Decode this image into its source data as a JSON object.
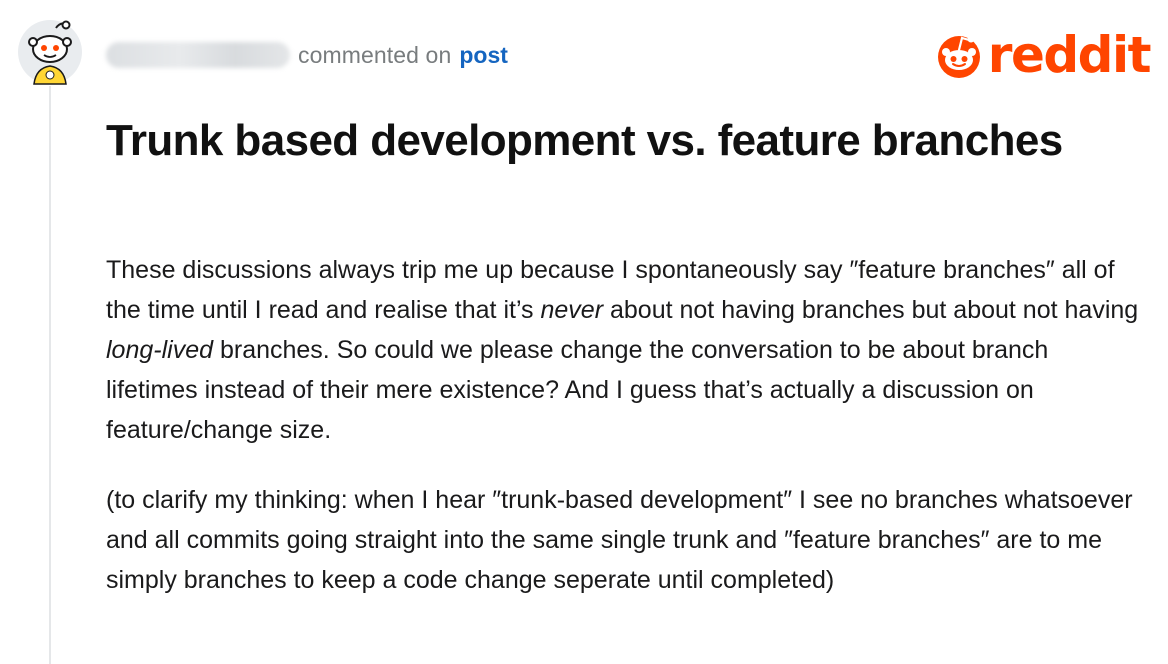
{
  "header": {
    "commented_on": "commented on",
    "post_link": "post"
  },
  "brand": {
    "wordmark": "reddit",
    "color": "#ff4500"
  },
  "post": {
    "title": "Trunk based development vs. feature branches"
  },
  "comment": {
    "p1_a": "These discussions always trip me up because I spontaneously say ″feature branches″ all of the time until I read and realise that it’s ",
    "p1_em1": "never",
    "p1_b": " about not having branches but about not having ",
    "p1_em2": "long-lived",
    "p1_c": " branches. So could we please change the conversation to be about branch lifetimes instead of their mere existence? And I guess that’s actually a discussion on feature/change size.",
    "p2": "(to clarify my thinking: when I hear ″trunk-based development″ I see no branches whatsoever and all commits going straight into the same single trunk and ″feature branches″ are to me simply branches to keep a code change seperate until completed)"
  },
  "icons": {
    "avatar": "snoo-avatar-icon",
    "brand": "reddit-snoo-icon"
  },
  "colors": {
    "link": "#1565c0",
    "muted": "#787c7e",
    "thread_line": "#e5e7e9"
  }
}
